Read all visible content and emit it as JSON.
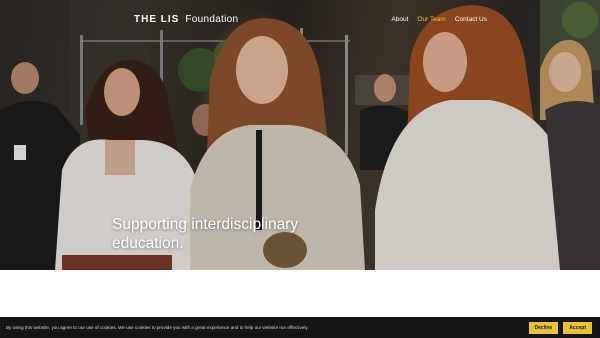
{
  "header": {
    "brand_strong": "THE LIS",
    "brand_light": "Foundation",
    "nav": [
      {
        "label": "About"
      },
      {
        "label": "Our Team"
      },
      {
        "label": "Contact Us"
      }
    ]
  },
  "hero": {
    "headline_line1": "Supporting interdisciplinary",
    "headline_line2": "education."
  },
  "cookie_banner": {
    "text": "By using this website, you agree to our use of cookies. We use cookies to provide you with a great experience and to help our website run effectively.",
    "decline_label": "Decline",
    "accept_label": "Accept"
  },
  "colors": {
    "accent": "#e8c33a",
    "banner_bg": "#151515"
  }
}
